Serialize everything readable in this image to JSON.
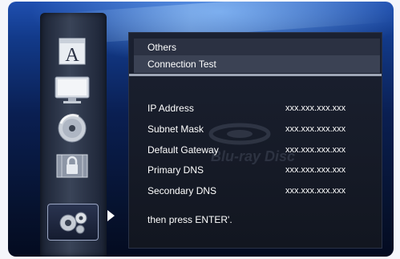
{
  "sidebar": {
    "items": [
      {
        "icon": "language-icon"
      },
      {
        "icon": "display-icon"
      },
      {
        "icon": "disc-icon"
      },
      {
        "icon": "lock-icon"
      },
      {
        "icon": "settings-gear-icon"
      }
    ]
  },
  "menu": {
    "others_label": "Others",
    "connection_test_label": "Connection Test"
  },
  "info": {
    "rows": [
      {
        "label": "IP Address",
        "value": "xxx.xxx.xxx.xxx"
      },
      {
        "label": "Subnet Mask",
        "value": "xxx.xxx.xxx.xxx"
      },
      {
        "label": "Default Gateway",
        "value": "xxx.xxx.xxx.xxx"
      },
      {
        "label": "Primary DNS",
        "value": "xxx.xxx.xxx.xxx"
      },
      {
        "label": "Secondary DNS",
        "value": "xxx.xxx.xxx.xxx"
      }
    ],
    "hint": "then press  ENTER'."
  },
  "watermark": {
    "text": "Blu-ray Disc"
  },
  "colors": {
    "background_top": "#1f4fb0",
    "background_bottom": "#040b20",
    "panel": "#1b2131",
    "highlight_row": "#3b4254",
    "divider": "#9ea6b6",
    "text": "#ffffff"
  }
}
